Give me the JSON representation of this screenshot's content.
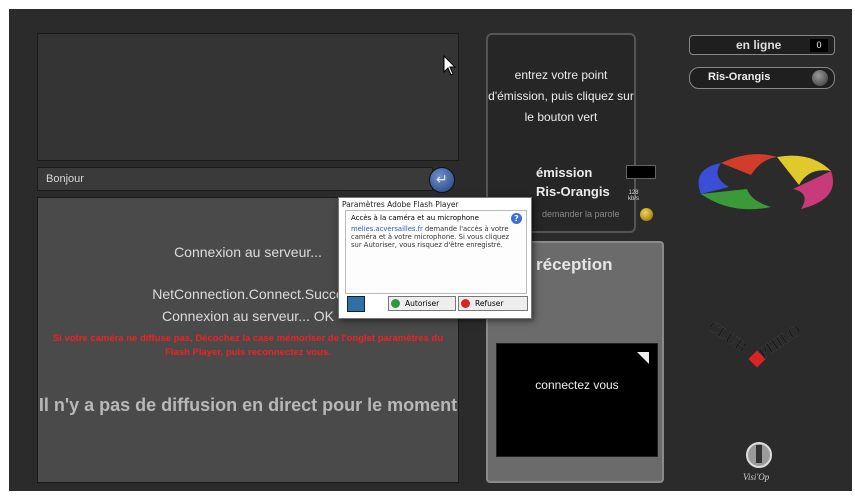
{
  "chat": {
    "input_value": "Bonjour"
  },
  "main": {
    "status_1": "Connexion au serveur...",
    "status_2": "NetConnection.Connect.Succe",
    "status_3": "Connexion au serveur...  OK",
    "warning": "Si votre caméra ne diffuse pas, Décochez la case mémoriser de l'onglet paramètres du Flash Player, puis reconnectez vous.",
    "no_stream": "Il n'y a pas de diffusion en direct pour le moment"
  },
  "emission": {
    "instructions": "entrez votre point d'émission, puis cliquez sur le bouton vert",
    "title": "émission",
    "city": "Ris-Orangis",
    "rate": "128 kb/s",
    "ask_word": "demander la parole"
  },
  "reception": {
    "title": "réception",
    "connect": "connectez vous"
  },
  "status": {
    "online_label": "en ligne",
    "online_count": "0",
    "city": "Ris-Orangis"
  },
  "logos": {
    "club": "CLUB",
    "philo": "PHILO",
    "visiop": "Visi'Op"
  },
  "flash": {
    "title": "Paramètres Adobe Flash Player",
    "heading": "Accès à la caméra et au microphone",
    "domain": "melies.acversailles.fr",
    "body": "demande l'accès à votre caméra et à votre microphone. Si vous cliquez sur Autoriser, vous risquez d'être enregistré.",
    "allow": "Autoriser",
    "deny": "Refuser"
  },
  "colors": {
    "warning": "#e22222",
    "allow": "#2c9a3a",
    "deny": "#dd2222"
  }
}
